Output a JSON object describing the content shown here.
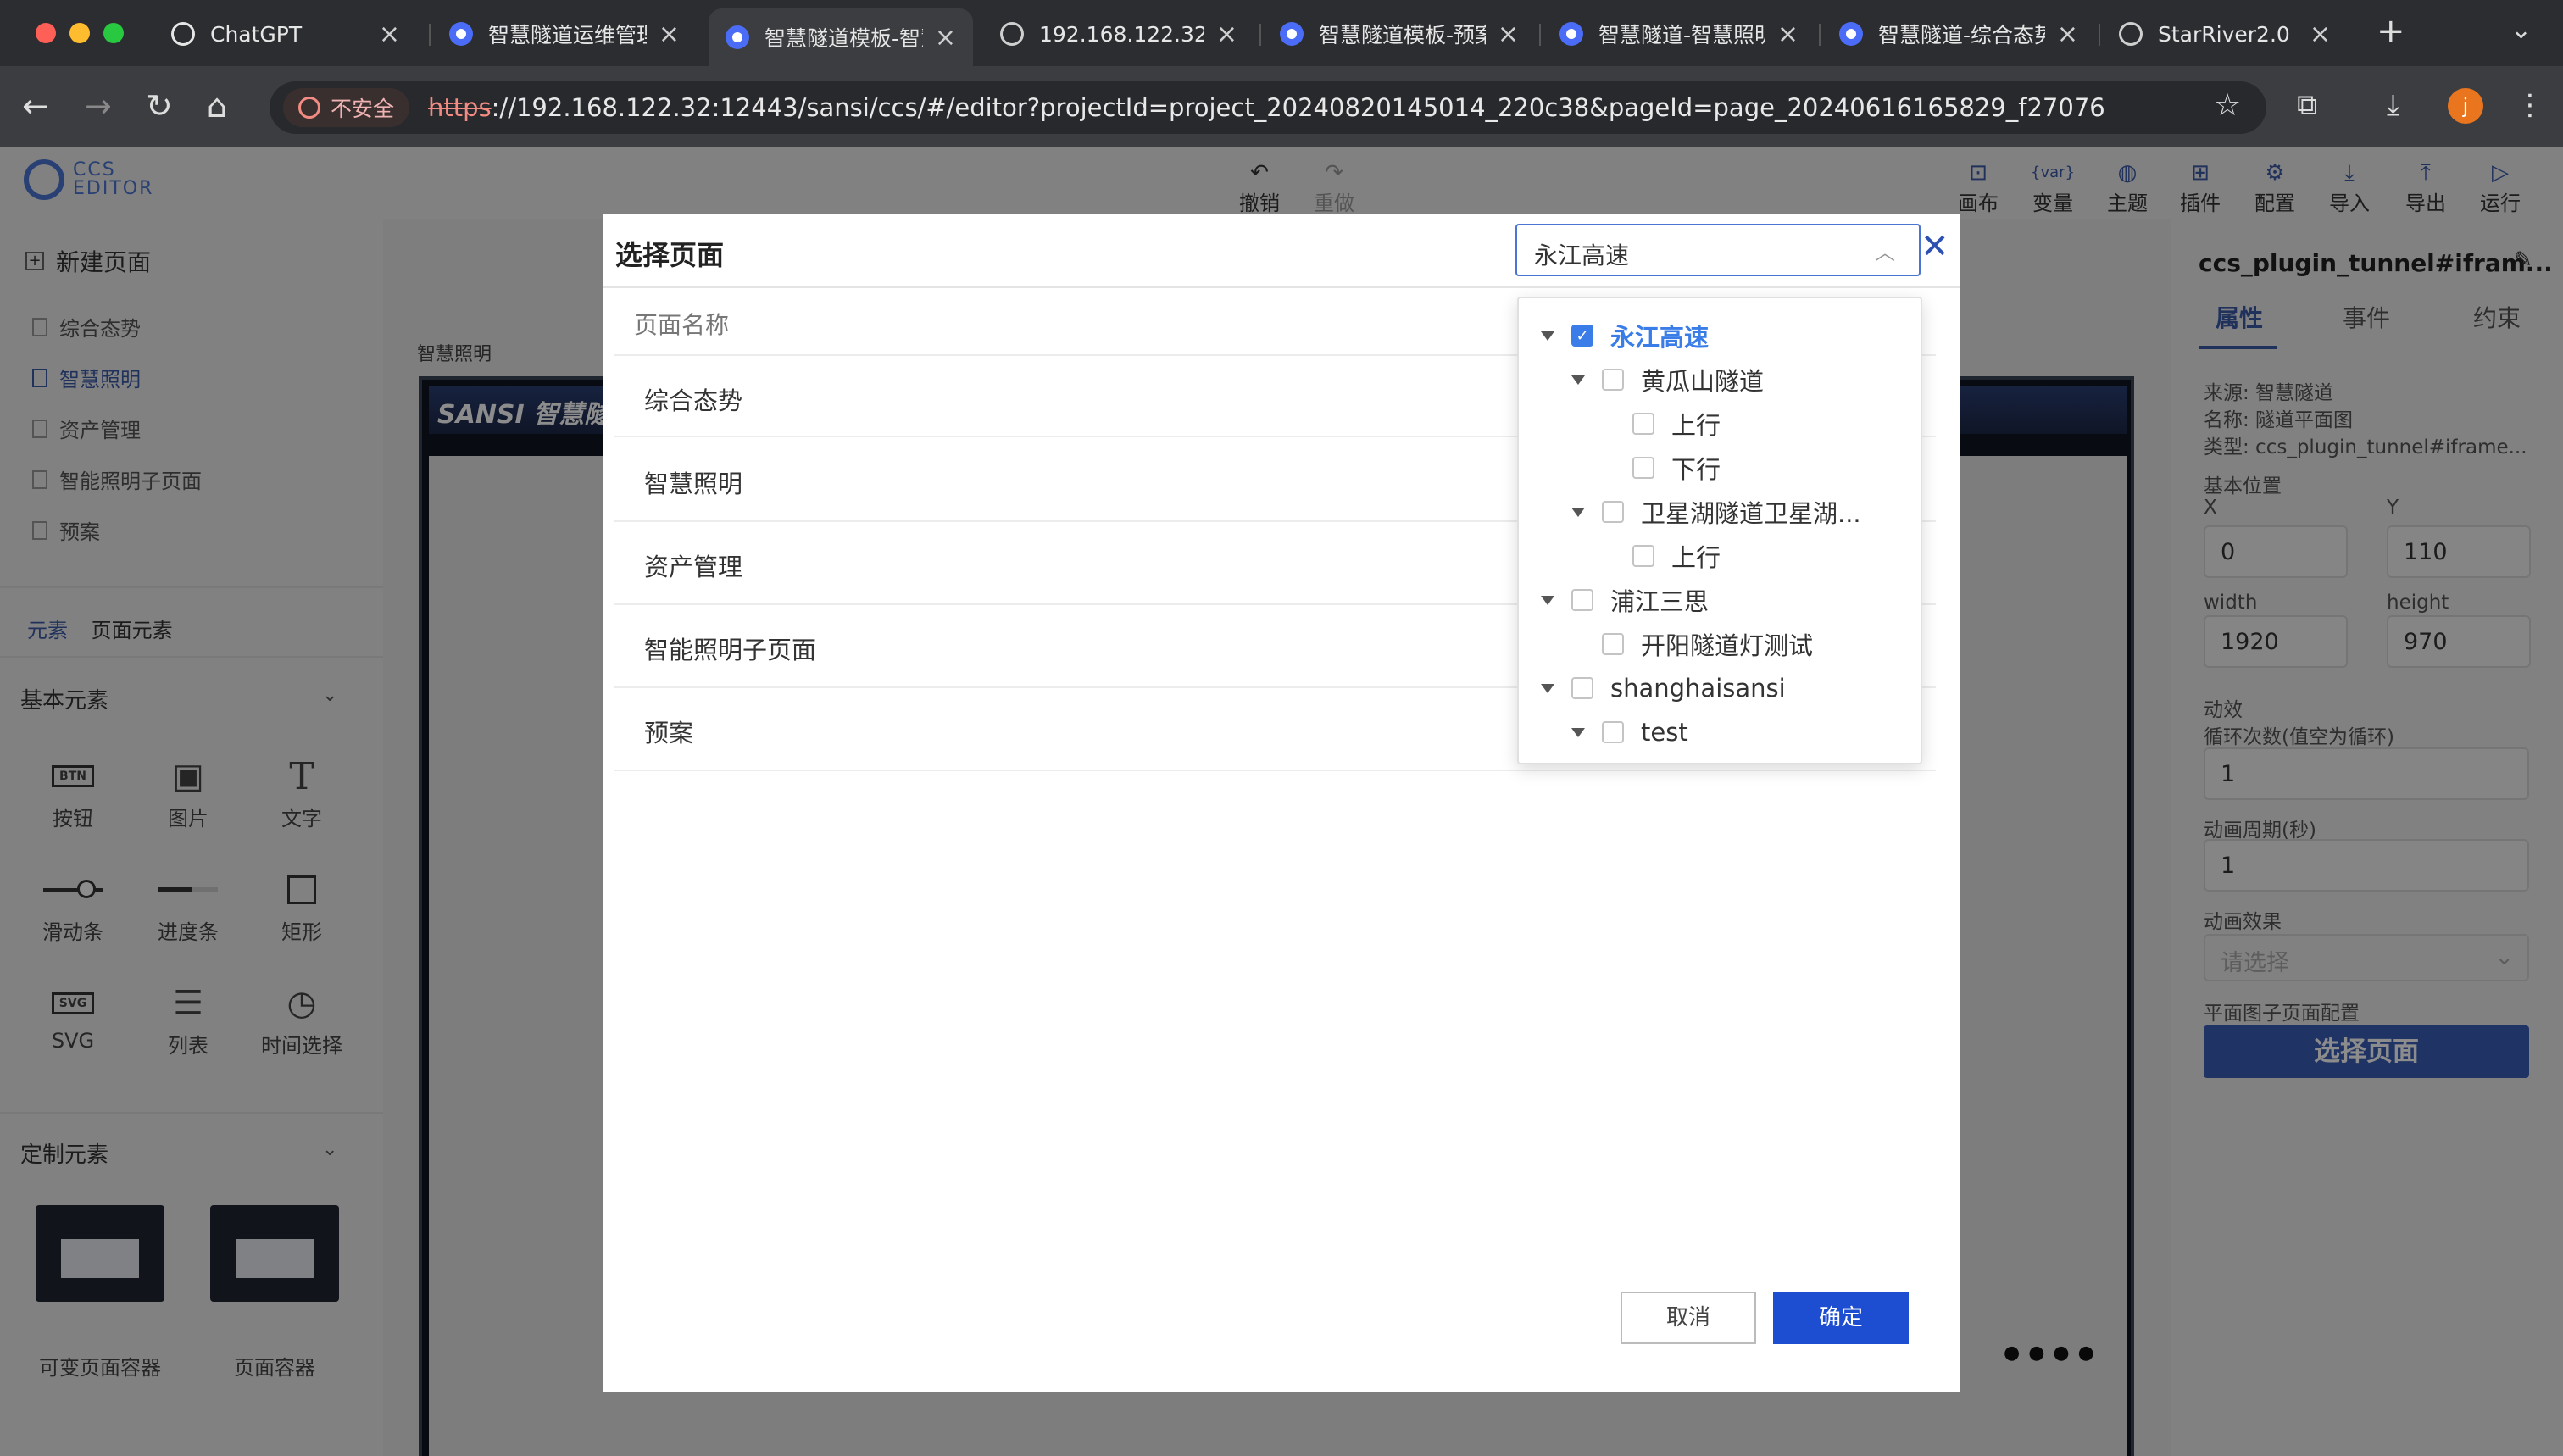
{
  "browser": {
    "tabs": [
      {
        "title": "ChatGPT",
        "icon": "chatgpt-icon"
      },
      {
        "title": "智慧隧道运维管理",
        "icon": "app-icon"
      },
      {
        "title": "智慧隧道模板-智慧",
        "icon": "app-icon",
        "active": true
      },
      {
        "title": "192.168.122.32",
        "icon": "globe-icon"
      },
      {
        "title": "智慧隧道模板-预案",
        "icon": "app-icon"
      },
      {
        "title": "智慧隧道-智慧照明",
        "icon": "app-icon"
      },
      {
        "title": "智慧隧道-综合态势",
        "icon": "app-icon"
      },
      {
        "title": "StarRiver2.0",
        "icon": "globe-icon"
      }
    ],
    "insecure_label": "不安全",
    "url_scheme": "https",
    "url_rest": "://192.168.122.32:12443/sansi/ccs/#/editor?projectId=project_20240820145014_220c38&pageId=page_20240616165829_f27076",
    "avatar_letter": "j"
  },
  "editor": {
    "logo_line1": "CCS",
    "logo_line2": "EDITOR",
    "undo": "撤销",
    "redo": "重做",
    "tools": [
      "画布",
      "变量",
      "主题",
      "插件",
      "配置",
      "导入",
      "导出",
      "运行"
    ],
    "new_page": "新建页面",
    "pages": [
      "综合态势",
      "智慧照明",
      "资产管理",
      "智能照明子页面",
      "预案"
    ],
    "element_tabs": [
      "元素",
      "页面元素"
    ],
    "basic_section": "基本元素",
    "basic_items": [
      "按钮",
      "图片",
      "文字",
      "滑动条",
      "进度条",
      "矩形",
      "SVG",
      "列表",
      "时间选择"
    ],
    "custom_section": "定制元素",
    "custom_items": [
      "可变页面容器",
      "页面容器"
    ],
    "canvas_label": "智慧照明",
    "canvas_brand": "SANSI 智慧隧道"
  },
  "props": {
    "title": "ccs_plugin_tunnel#ifram...",
    "tabs": [
      "属性",
      "事件",
      "约束"
    ],
    "source": "来源: 智慧隧道",
    "name": "名称: 隧道平面图",
    "type": "类型: ccs_plugin_tunnel#iframe...",
    "basic_pos": "基本位置",
    "x_label": "X",
    "y_label": "Y",
    "x_val": "0",
    "y_val": "110",
    "w_label": "width",
    "h_label": "height",
    "w_val": "1920",
    "h_val": "970",
    "anim": "动效",
    "loop_label": "循环次数(值空为循环)",
    "loop_val": "1",
    "period_label": "动画周期(秒)",
    "period_val": "1",
    "effect_label": "动画效果",
    "effect_placeholder": "请选择",
    "sub_page_cfg": "平面图子页面配置",
    "choose_page": "选择页面"
  },
  "modal": {
    "title": "选择页面",
    "selected_project": "永江高速",
    "column_header": "页面名称",
    "rows": [
      "综合态势",
      "智慧照明",
      "资产管理",
      "智能照明子页面",
      "预案"
    ],
    "cancel": "取消",
    "ok": "确定",
    "tree": [
      {
        "label": "永江高速",
        "level": 0,
        "expanded": true,
        "checked": true
      },
      {
        "label": "黄瓜山隧道",
        "level": 1,
        "expanded": true,
        "checked": false
      },
      {
        "label": "上行",
        "level": 2,
        "leaf": true,
        "checked": false
      },
      {
        "label": "下行",
        "level": 2,
        "leaf": true,
        "checked": false
      },
      {
        "label": "卫星湖隧道卫星湖...",
        "level": 1,
        "expanded": true,
        "checked": false
      },
      {
        "label": "上行",
        "level": 2,
        "leaf": true,
        "checked": false
      },
      {
        "label": "浦江三思",
        "level": 0,
        "expanded": true,
        "checked": false
      },
      {
        "label": "开阳隧道灯测试",
        "level": 1,
        "leaf": true,
        "checked": false
      },
      {
        "label": "shanghaisansi",
        "level": 0,
        "expanded": true,
        "checked": false
      },
      {
        "label": "test",
        "level": 1,
        "expanded": true,
        "checked": false
      }
    ]
  },
  "colors": {
    "accent": "#3b5aa8",
    "primary_button": "#1d4ed1",
    "checkbox_checked": "#3b7de8"
  }
}
